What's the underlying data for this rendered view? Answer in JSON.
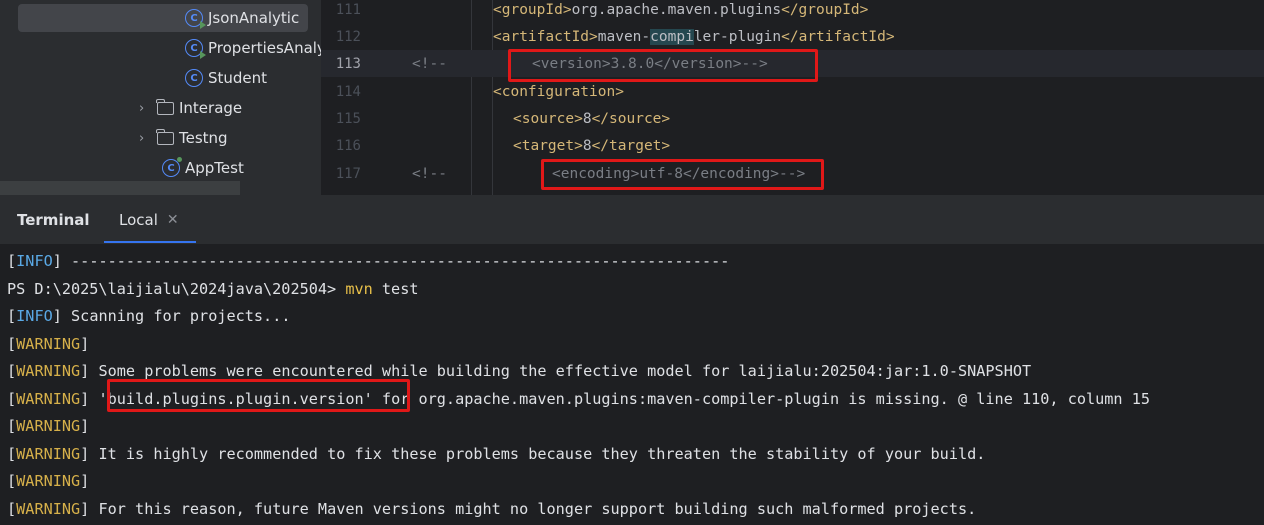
{
  "project_tree": {
    "items": [
      {
        "label": "JsonAnalytic",
        "icon": "class-run-icon",
        "selected": true
      },
      {
        "label": "PropertiesAnalytic",
        "icon": "class-run-icon"
      },
      {
        "label": "Student",
        "icon": "class-icon"
      },
      {
        "label": "Interage",
        "icon": "folder-icon",
        "collapsible": true
      },
      {
        "label": "Testng",
        "icon": "folder-icon",
        "collapsible": true
      },
      {
        "label": "AppTest",
        "icon": "class-dot-icon"
      }
    ]
  },
  "editor": {
    "lines": [
      {
        "number": "111",
        "open": "<groupId>",
        "text": "org.apache.maven.plugins",
        "close": "</groupId>"
      },
      {
        "number": "112",
        "open": "<artifactId>",
        "text_before": "maven-",
        "text_highlight": "compi",
        "text_after": "ler-plugin",
        "close": "</artifactId>"
      },
      {
        "number": "113",
        "comment_marker": "<!--",
        "comment": "<version>3.8.0</version>-->",
        "current": true
      },
      {
        "number": "114",
        "open": "<configuration>"
      },
      {
        "number": "115",
        "open": "<source>",
        "text": "8",
        "close": "</source>"
      },
      {
        "number": "116",
        "open": "<target>",
        "text": "8",
        "close": "</target>"
      },
      {
        "number": "117",
        "comment_marker": "<!--",
        "open": "<encoding>",
        "text": "utf-8",
        "close": "</encoding>",
        "trail": "-->"
      }
    ]
  },
  "terminal": {
    "tab_title": "Terminal",
    "tabs": [
      {
        "label": "Local",
        "active": true
      }
    ],
    "lines": [
      {
        "level": "INFO",
        "text": " ------------------------------------------------------------------------"
      },
      {
        "prompt": "PS D:\\2025\\laijialu\\2024java\\202504> ",
        "command": "mvn",
        "args": " test"
      },
      {
        "level": "INFO",
        "text": " Scanning for projects..."
      },
      {
        "level": "WARNING",
        "text": ""
      },
      {
        "level": "WARNING",
        "text": " Some problems were encountered while building the effective model for laijialu:202504:jar:1.0-SNAPSHOT"
      },
      {
        "level": "WARNING",
        "text_boxed": " 'build.plugins.plugin.version'",
        "text": " for org.apache.maven.plugins:maven-compiler-plugin is missing. @ line 110, column 15"
      },
      {
        "level": "WARNING",
        "text": ""
      },
      {
        "level": "WARNING",
        "text": " It is highly recommended to fix these problems because they threaten the stability of your build."
      },
      {
        "level": "WARNING",
        "text": ""
      },
      {
        "level": "WARNING",
        "text": " For this reason, future Maven versions might no longer support building such malformed projects."
      }
    ]
  },
  "colors": {
    "accent": "#3574f0",
    "annotation_box": "#e01818",
    "xml_tag": "#d5b778",
    "info": "#5aa9e6",
    "warning": "#d6b04a"
  }
}
